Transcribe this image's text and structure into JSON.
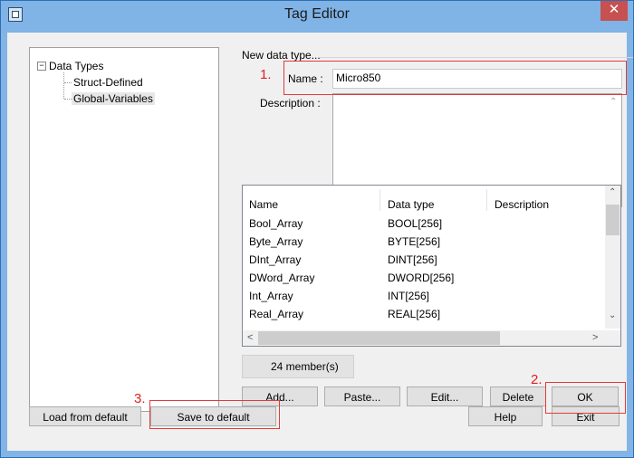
{
  "window": {
    "title": "Tag Editor",
    "close_glyph": "✕"
  },
  "tree": {
    "root_label": "Data Types",
    "expander_glyph": "−",
    "children": [
      "Struct-Defined",
      "Global-Variables"
    ]
  },
  "form": {
    "group_title": "New data type...",
    "name_label": "Name :",
    "name_value": "Micro850",
    "description_label": "Description :",
    "description_value": ""
  },
  "table": {
    "columns": [
      "Name",
      "Data type",
      "Description"
    ],
    "rows": [
      {
        "name": "Bool_Array",
        "type": "BOOL[256]"
      },
      {
        "name": "Byte_Array",
        "type": "BYTE[256]"
      },
      {
        "name": "DInt_Array",
        "type": "DINT[256]"
      },
      {
        "name": "DWord_Array",
        "type": "DWORD[256]"
      },
      {
        "name": "Int_Array",
        "type": "INT[256]"
      },
      {
        "name": "Real_Array",
        "type": "REAL[256]"
      }
    ]
  },
  "member_count": "24 member(s)",
  "buttons": {
    "add": "Add...",
    "paste": "Paste...",
    "edit": "Edit...",
    "delete": "Delete",
    "ok": "OK",
    "load_default": "Load from default",
    "save_default": "Save to default",
    "help": "Help",
    "exit": "Exit"
  },
  "annotations": {
    "step1": "1.",
    "step2": "2.",
    "step3": "3."
  },
  "scroll_glyphs": {
    "up": "⌃",
    "down": "⌄",
    "left": "<",
    "right": ">"
  },
  "colors": {
    "title_bar": "#80b3e6",
    "close_button": "#c75050",
    "annotation_red": "#e23b3b"
  },
  "icons": {
    "app": "window-icon",
    "close": "close-icon"
  }
}
